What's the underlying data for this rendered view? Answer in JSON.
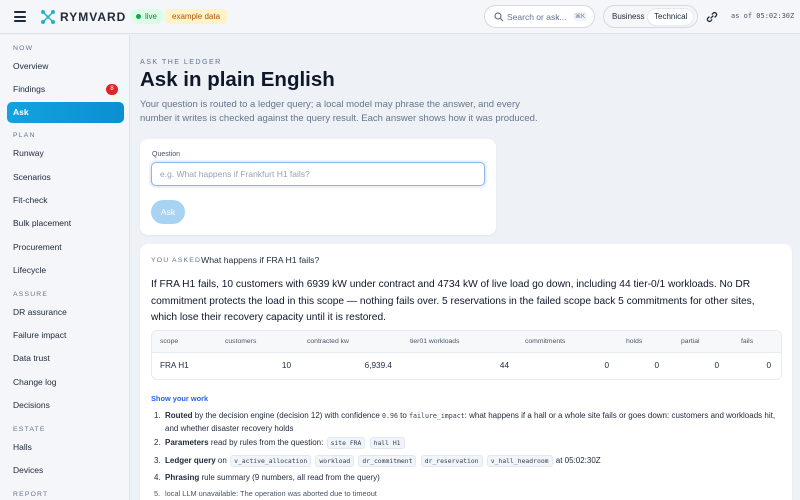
{
  "topbar": {
    "brand": "RYMVARD",
    "live_label": "live",
    "example_label": "example data",
    "search_placeholder": "Search or ask...",
    "search_shortcut": "⌘K",
    "view_modes": [
      "Business",
      "Technical"
    ],
    "active_view": "Technical",
    "as_of": "as of 05:02:30Z"
  },
  "sidebar": {
    "sections": [
      {
        "title": "NOW",
        "items": [
          {
            "label": "Overview"
          },
          {
            "label": "Findings",
            "badge": "8"
          },
          {
            "label": "Ask",
            "active": true
          }
        ]
      },
      {
        "title": "PLAN",
        "items": [
          {
            "label": "Runway"
          },
          {
            "label": "Scenarios"
          },
          {
            "label": "Fit-check"
          },
          {
            "label": "Bulk placement"
          },
          {
            "label": "Procurement"
          },
          {
            "label": "Lifecycle"
          }
        ]
      },
      {
        "title": "ASSURE",
        "items": [
          {
            "label": "DR assurance"
          },
          {
            "label": "Failure impact"
          },
          {
            "label": "Data trust"
          },
          {
            "label": "Change log"
          },
          {
            "label": "Decisions"
          }
        ]
      },
      {
        "title": "ESTATE",
        "items": [
          {
            "label": "Halls"
          },
          {
            "label": "Devices"
          }
        ]
      },
      {
        "title": "REPORT",
        "items": []
      }
    ]
  },
  "page": {
    "eyebrow": "ASK THE LEDGER",
    "title": "Ask in plain English",
    "lead": "Your question is routed to a ledger query; a local model may phrase the answer, and every number it writes is checked against the query result. Each answer shows how it was produced."
  },
  "question": {
    "label": "Question",
    "placeholder": "e.g. What happens if Frankfurt H1 fails?",
    "button": "Ask"
  },
  "answer": {
    "you_asked_label": "YOU ASKED",
    "question": "What happens if FRA H1 fails?",
    "text": "If FRA H1 fails, 10 customers with 6939 kW under contract and 4734 kW of live load go down, including 44 tier-0/1 workloads. No DR commitment protects the load in this scope — nothing fails over. 5 reservations in the failed scope back 5 commitments for other sites, which lose their recovery capacity until it is restored.",
    "table": {
      "columns": [
        "scope",
        "customers",
        "contracted kw",
        "tier01 workloads",
        "commitments",
        "holds",
        "partial",
        "fails"
      ],
      "rows": [
        [
          "FRA H1",
          "10",
          "6,939.4",
          "44",
          "0",
          "0",
          "0",
          "0"
        ]
      ]
    },
    "show_work": "Show your work",
    "steps": {
      "s1": {
        "n": "1.",
        "title": "Routed",
        "a": "by the decision engine (decision 12) with confidence",
        "conf": "0.96",
        "b": "to",
        "target": "failure_impact",
        "c": ": what happens if a hall or a whole site fails or goes down: customers and workloads hit, and whether disaster recovery holds"
      },
      "s2": {
        "n": "2.",
        "title": "Parameters",
        "a": "read by rules from the question:",
        "chips": [
          "site FRA",
          "hall H1"
        ]
      },
      "s3": {
        "n": "3.",
        "title": "Ledger query",
        "a": "on",
        "chips": [
          "v_active_allocation",
          "workload",
          "dr_commitment",
          "dr_reservation",
          "v_hall_headroom"
        ],
        "b": "at 05:02:30Z"
      },
      "s4": {
        "n": "4.",
        "title": "Phrasing",
        "a": "rule summary (9 numbers, all read from the query)"
      },
      "s5": {
        "n": "5.",
        "a": "local LLM unavailable: The operation was aborted due to timeout"
      }
    }
  },
  "colors": {
    "accent": "#0ea5e9",
    "badge": "#dc2626",
    "live": "#16a34a",
    "link": "#2563eb"
  }
}
